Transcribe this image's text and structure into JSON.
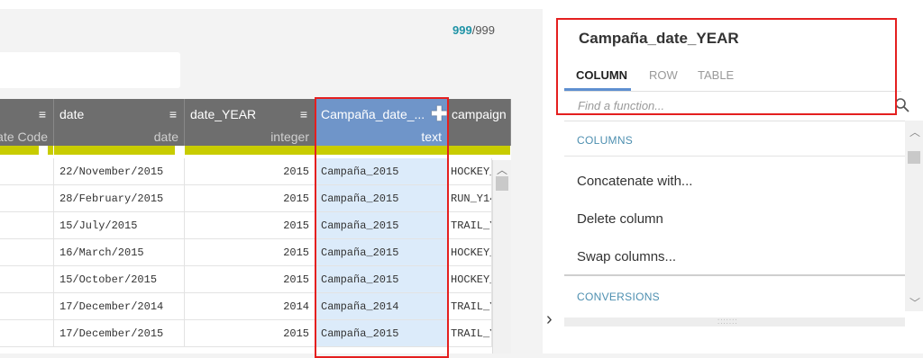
{
  "row_count": {
    "selected": "999",
    "total": "/999"
  },
  "columns": [
    {
      "name": "",
      "type": "ate Code"
    },
    {
      "name": "date",
      "type": "date"
    },
    {
      "name": "date_YEAR",
      "type": "integer"
    },
    {
      "name": "Campaña_date_...",
      "type": "text"
    },
    {
      "name": "campaign",
      "type": ""
    }
  ],
  "rows": [
    {
      "date": "22/November/2015",
      "year": "2015",
      "campana": "Campaña_2015",
      "campaign": "HOCKEY_"
    },
    {
      "date": "28/February/2015",
      "year": "2015",
      "campana": "Campaña_2015",
      "campaign": "RUN_Y14"
    },
    {
      "date": "15/July/2015",
      "year": "2015",
      "campana": "Campaña_2015",
      "campaign": "TRAIL_Y"
    },
    {
      "date": "16/March/2015",
      "year": "2015",
      "campana": "Campaña_2015",
      "campaign": "HOCKEY_"
    },
    {
      "date": "15/October/2015",
      "year": "2015",
      "campana": "Campaña_2015",
      "campaign": "HOCKEY_"
    },
    {
      "date": "17/December/2014",
      "year": "2014",
      "campana": "Campaña_2014",
      "campaign": "TRAIL_Y"
    },
    {
      "date": "17/December/2015",
      "year": "2015",
      "campana": "Campaña_2015",
      "campaign": "TRAIL_Y"
    }
  ],
  "panel": {
    "title": "Campaña_date_YEAR",
    "tabs": [
      "COLUMN",
      "ROW",
      "TABLE"
    ],
    "search_placeholder": "Find a function...",
    "sections": {
      "columns": "COLUMNS",
      "conversions": "CONVERSIONS"
    },
    "items": [
      "Concatenate with...",
      "Delete column",
      "Swap columns..."
    ]
  },
  "colors": {
    "selected_header": "#6f95c9",
    "selected_cells": "#dcebfa",
    "quality_bar": "#c8cc00",
    "highlight_box": "#e41f1f",
    "accent_tab": "#5e8fd0"
  }
}
